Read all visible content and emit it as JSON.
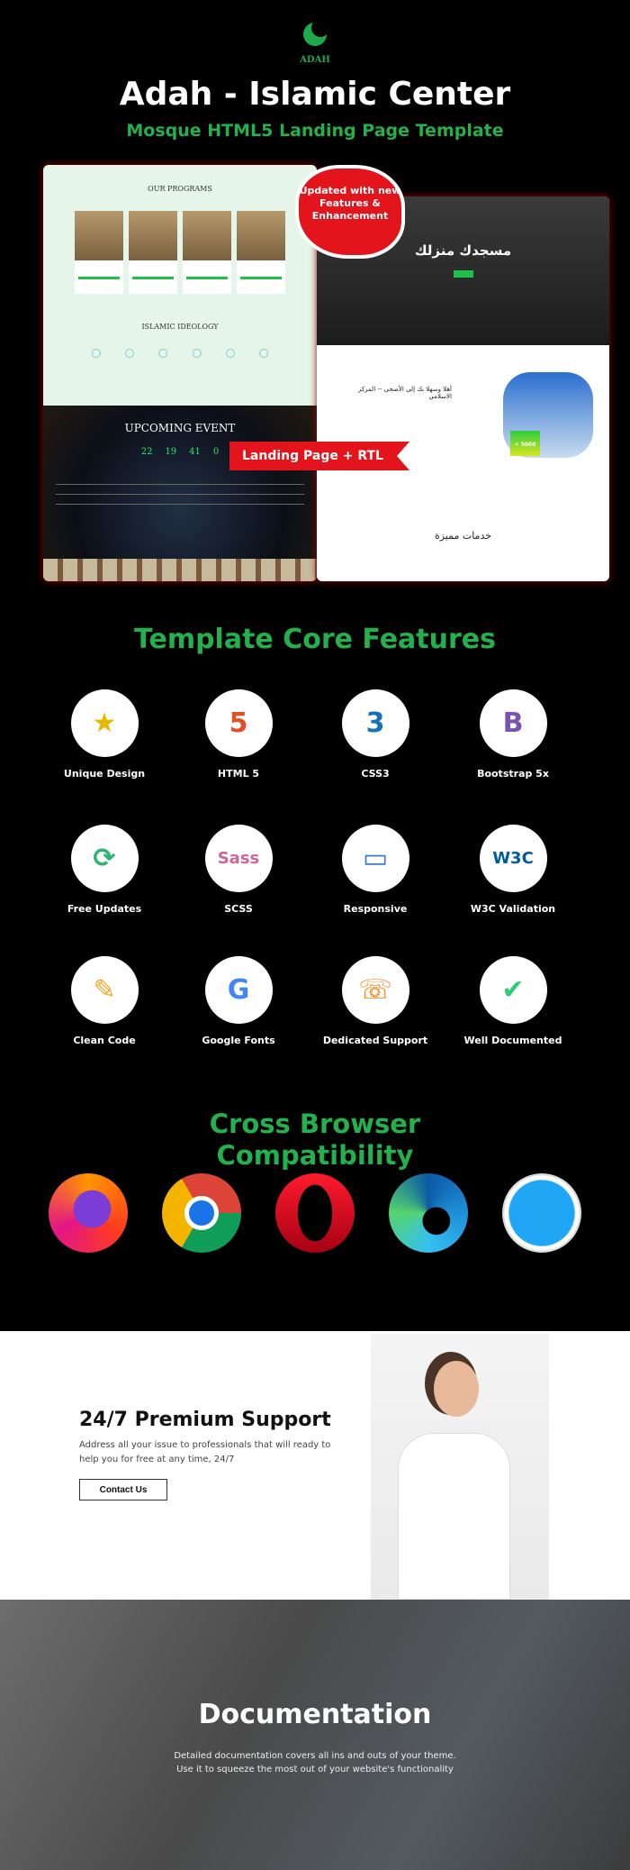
{
  "header": {
    "logo_text": "ADAH",
    "title": "Adah - Islamic Center",
    "subtitle": "Mosque HTML5 Landing Page Template"
  },
  "preview": {
    "programs_heading": "OUR PROGRAMS",
    "ideology_heading": "ISLAMIC IDEOLOGY",
    "event_heading": "UPCOMING EVENT",
    "countdown": [
      "22",
      "19",
      "41",
      "0"
    ],
    "hero_title": "مسجدك منزلك",
    "about_title": "أهلا وسهلا بك إلى الأضحى -- المركز الاسلامي",
    "stat": "+ 5000",
    "services_title": "خدمات مميزة",
    "badge": "Updated with new Features & Enhancement",
    "ribbon": "Landing Page + RTL"
  },
  "features": {
    "title": "Template Core Features",
    "items": [
      {
        "label": "Unique Design",
        "icon": "award-boxes-icon"
      },
      {
        "label": "HTML 5",
        "icon": "html5-icon"
      },
      {
        "label": "CSS3",
        "icon": "css3-icon"
      },
      {
        "label": "Bootstrap 5x",
        "icon": "bootstrap-icon"
      },
      {
        "label": "Free Updates",
        "icon": "monitor-refresh-icon"
      },
      {
        "label": "SCSS",
        "icon": "sass-icon"
      },
      {
        "label": "Responsive",
        "icon": "devices-icon"
      },
      {
        "label": "W3C Validation",
        "icon": "w3c-icon"
      },
      {
        "label": "Clean Code",
        "icon": "brush-icon"
      },
      {
        "label": "Google Fonts",
        "icon": "google-fonts-icon"
      },
      {
        "label": "Dedicated Support",
        "icon": "headset-icon"
      },
      {
        "label": "Well Documented",
        "icon": "document-check-icon"
      }
    ]
  },
  "browsers": {
    "title_line1": "Cross Browser",
    "title_line2": "Compatibility",
    "items": [
      "firefox",
      "chrome",
      "opera",
      "edge",
      "safari"
    ]
  },
  "support": {
    "title": "24/7 Premium Support",
    "text": "Address all your issue to professionals that will ready to help you for free at any time, 24/7",
    "button": "Contact Us"
  },
  "documentation": {
    "title": "Documentation",
    "line1": "Detailed documentation covers all ins and outs of your theme.",
    "line2": "Use it to squeeze the most out of your website's functionality"
  },
  "colors": {
    "accent": "#22b14c",
    "badge": "#e3141c"
  }
}
